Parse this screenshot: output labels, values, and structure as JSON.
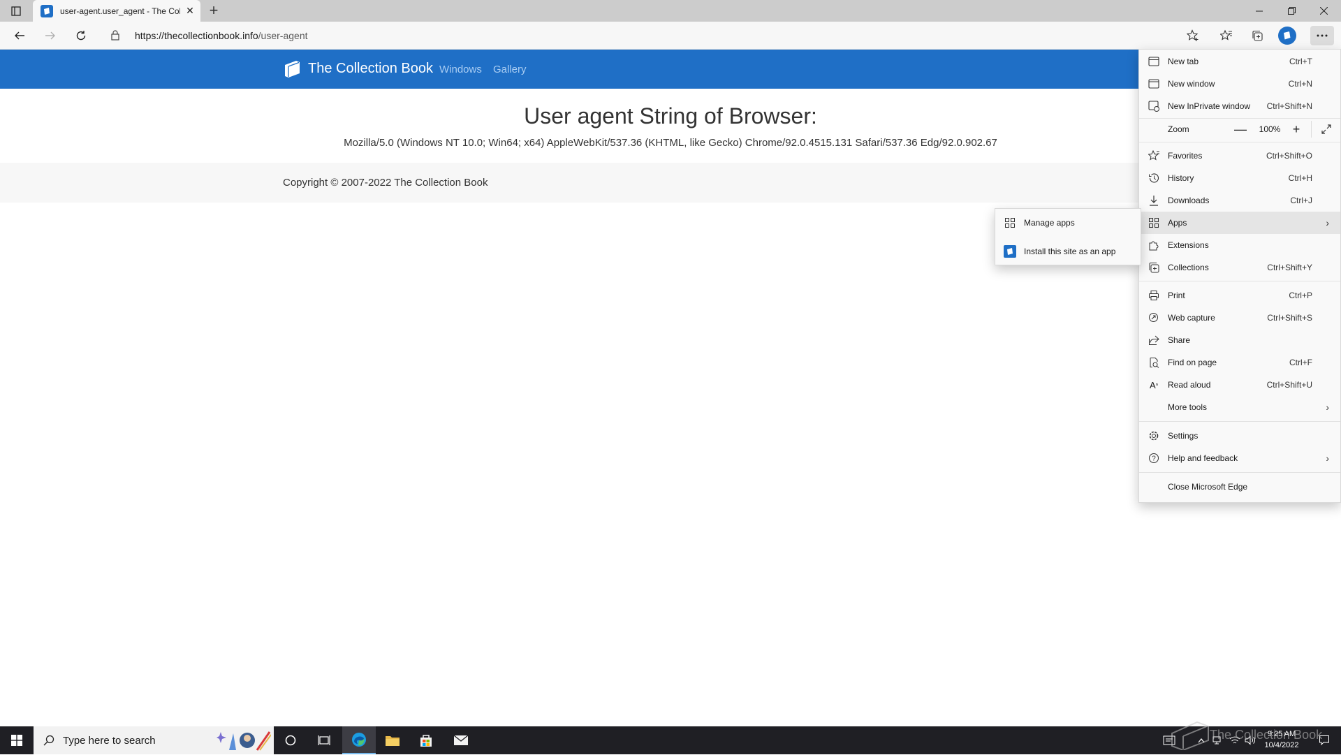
{
  "browser": {
    "tab_title": "user-agent.user_agent - The Coll",
    "url_domain": "https://thecollectionbook.info",
    "url_path": "/user-agent"
  },
  "site": {
    "brand": "The Collection Book",
    "nav": [
      "Windows",
      "Gallery"
    ],
    "heading": "User agent String of Browser:",
    "ua": "Mozilla/5.0 (Windows NT 10.0; Win64; x64) AppleWebKit/537.36 (KHTML, like Gecko) Chrome/92.0.4515.131 Safari/537.36 Edg/92.0.902.67",
    "footer": "Copyright © 2007-2022 The Collection Book"
  },
  "menu": {
    "new_tab": {
      "label": "New tab",
      "shortcut": "Ctrl+T"
    },
    "new_window": {
      "label": "New window",
      "shortcut": "Ctrl+N"
    },
    "new_inprivate": {
      "label": "New InPrivate window",
      "shortcut": "Ctrl+Shift+N"
    },
    "zoom": {
      "label": "Zoom",
      "value": "100%"
    },
    "favorites": {
      "label": "Favorites",
      "shortcut": "Ctrl+Shift+O"
    },
    "history": {
      "label": "History",
      "shortcut": "Ctrl+H"
    },
    "downloads": {
      "label": "Downloads",
      "shortcut": "Ctrl+J"
    },
    "apps": {
      "label": "Apps"
    },
    "extensions": {
      "label": "Extensions"
    },
    "collections": {
      "label": "Collections",
      "shortcut": "Ctrl+Shift+Y"
    },
    "print": {
      "label": "Print",
      "shortcut": "Ctrl+P"
    },
    "web_capture": {
      "label": "Web capture",
      "shortcut": "Ctrl+Shift+S"
    },
    "share": {
      "label": "Share"
    },
    "find": {
      "label": "Find on page",
      "shortcut": "Ctrl+F"
    },
    "read_aloud": {
      "label": "Read aloud",
      "shortcut": "Ctrl+Shift+U"
    },
    "more_tools": {
      "label": "More tools"
    },
    "settings": {
      "label": "Settings"
    },
    "help": {
      "label": "Help and feedback"
    },
    "close_edge": {
      "label": "Close Microsoft Edge"
    }
  },
  "apps_submenu": {
    "manage": "Manage apps",
    "install": "Install this site as an app"
  },
  "taskbar": {
    "search_placeholder": "Type here to search",
    "time": "9:25 AM",
    "date": "10/4/2022"
  },
  "watermark": "The Collection Book",
  "colors": {
    "site_header": "#1f6fc6",
    "nav_link": "#a9cdf3",
    "taskbar": "#1f1f24"
  }
}
